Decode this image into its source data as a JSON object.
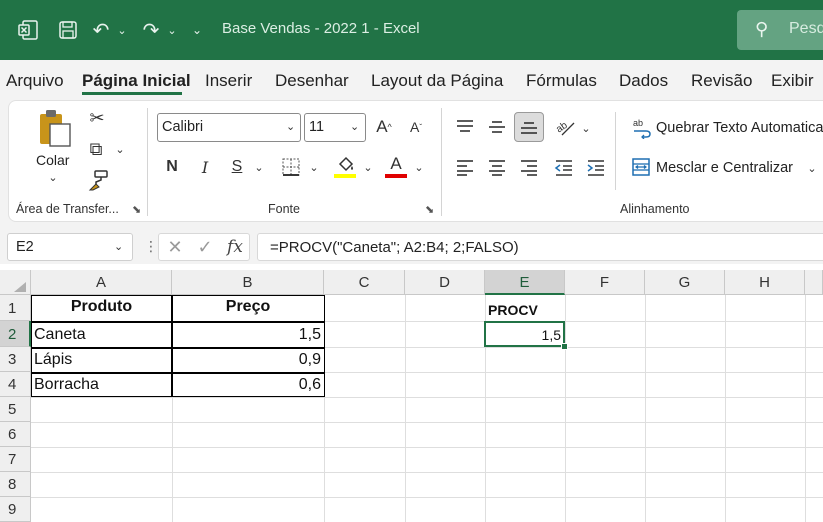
{
  "titlebar": {
    "title": "Base Vendas - 2022 1  -  Excel",
    "search_placeholder": "Pesq",
    "icons": [
      "excel-icon",
      "autosave-icon",
      "undo-icon",
      "redo-icon",
      "customize-qat-icon",
      "search-icon"
    ],
    "bg_color": "#217346"
  },
  "tabs": [
    {
      "label": "Arquivo"
    },
    {
      "label": "Página Inicial",
      "active": true
    },
    {
      "label": "Inserir"
    },
    {
      "label": "Desenhar"
    },
    {
      "label": "Layout da Página"
    },
    {
      "label": "Fórmulas"
    },
    {
      "label": "Dados"
    },
    {
      "label": "Revisão"
    },
    {
      "label": "Exibir"
    }
  ],
  "ribbon": {
    "clipboard": {
      "label": "Área de Transfer...",
      "paste_label": "Colar"
    },
    "font": {
      "label": "Fonte",
      "font_name": "Calibri",
      "font_size": "11",
      "bold": "N",
      "italic": "I",
      "underline": "S",
      "fill_color": "#ffff00",
      "font_color": "#e00000"
    },
    "alignment": {
      "label": "Alinhamento",
      "wrap_text": "Quebrar Texto Automatica",
      "merge_center": "Mesclar e Centralizar"
    }
  },
  "formula_bar": {
    "name_box": "E2",
    "formula": "=PROCV(\"Caneta\"; A2:B4; 2;FALSO)",
    "fx_label": "fx"
  },
  "grid": {
    "columns": [
      "A",
      "B",
      "C",
      "D",
      "E",
      "F",
      "G",
      "H"
    ],
    "rows": [
      "1",
      "2",
      "3",
      "4",
      "5",
      "6",
      "7",
      "8",
      "9"
    ],
    "selected_column": "E",
    "selected_row": "2",
    "table": {
      "headers": [
        "Produto",
        "Preço"
      ],
      "rows": [
        {
          "produto": "Caneta",
          "preco": "1,5"
        },
        {
          "produto": "Lápis",
          "preco": "0,9"
        },
        {
          "produto": "Borracha",
          "preco": "0,6"
        }
      ]
    },
    "procv_label": "PROCV",
    "procv_result": "1,5"
  }
}
